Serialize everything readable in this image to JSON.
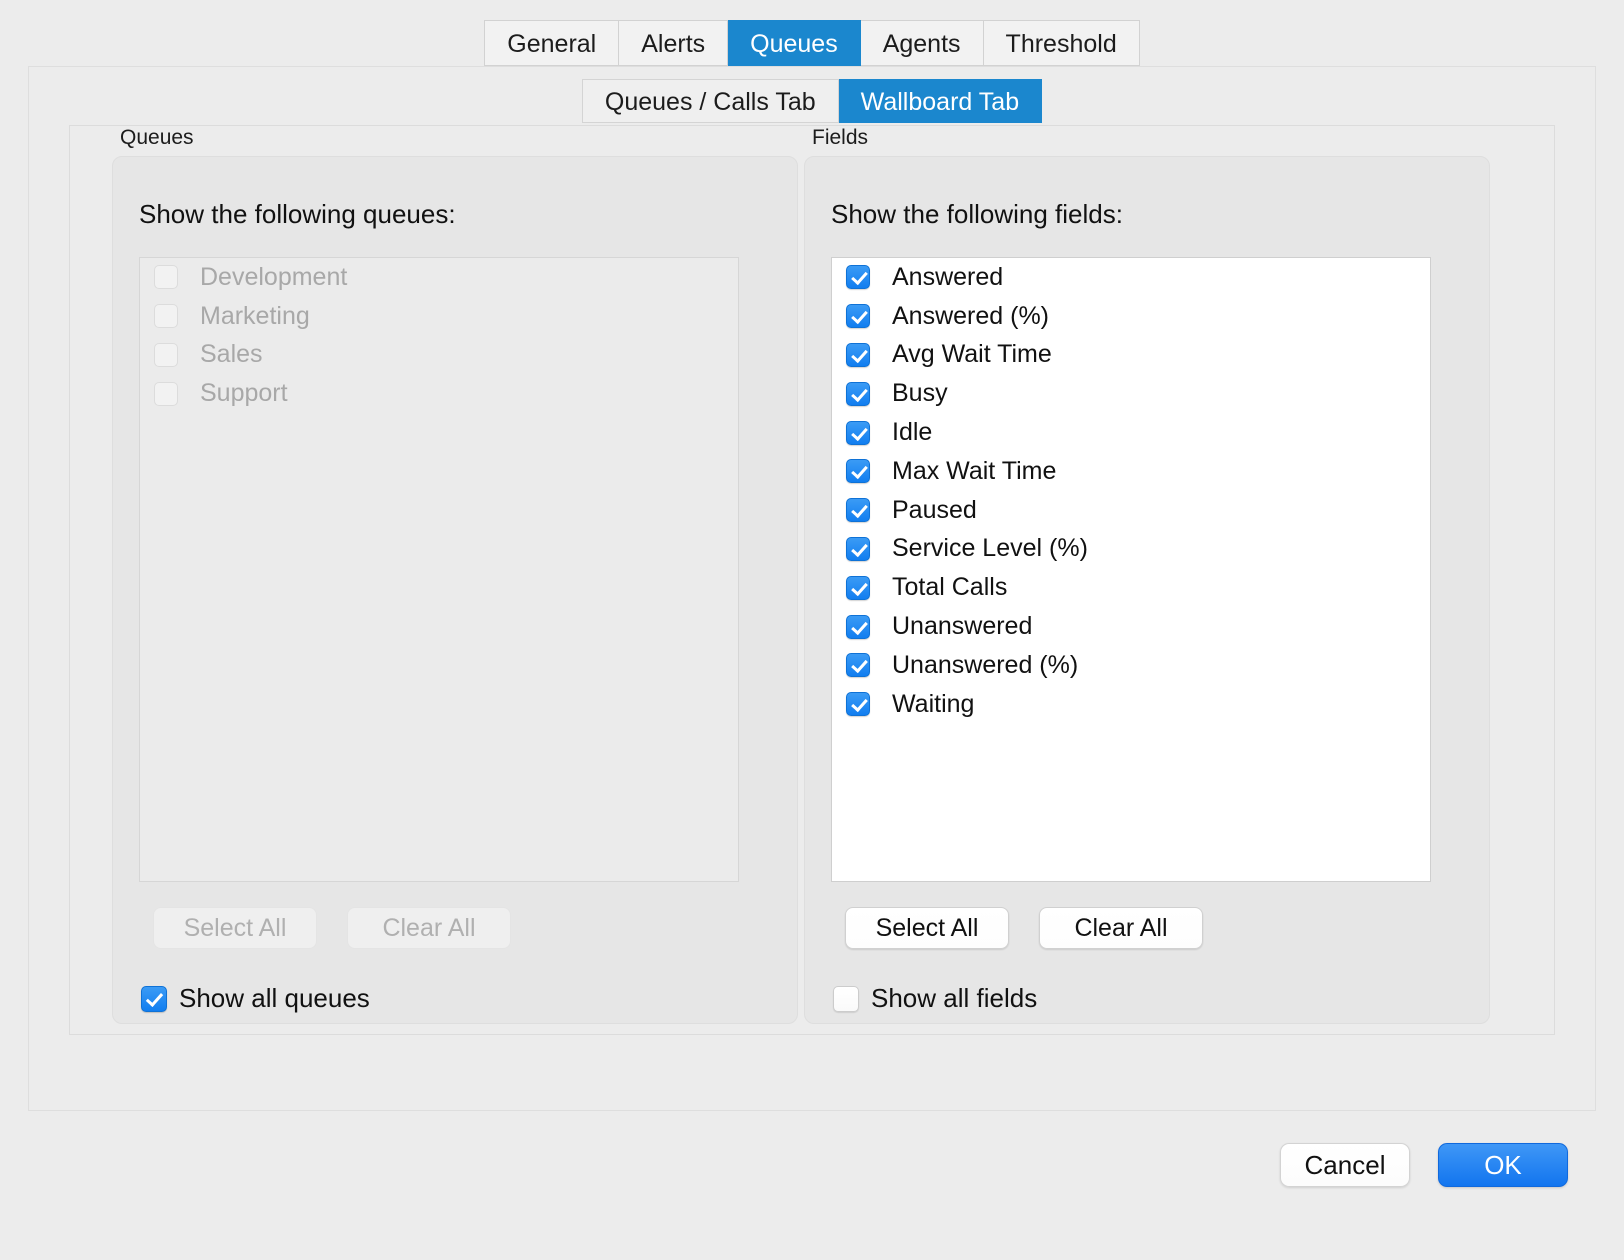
{
  "tabs": [
    {
      "label": "General",
      "active": false
    },
    {
      "label": "Alerts",
      "active": false
    },
    {
      "label": "Queues",
      "active": true
    },
    {
      "label": "Agents",
      "active": false
    },
    {
      "label": "Threshold",
      "active": false
    }
  ],
  "subtabs": [
    {
      "label": "Queues / Calls Tab",
      "active": false
    },
    {
      "label": "Wallboard Tab",
      "active": true
    }
  ],
  "queues_group": {
    "title": "Queues",
    "heading": "Show the following queues:",
    "enabled": false,
    "items": [
      {
        "label": "Development",
        "checked": false
      },
      {
        "label": "Marketing",
        "checked": false
      },
      {
        "label": "Sales",
        "checked": false
      },
      {
        "label": "Support",
        "checked": false
      }
    ],
    "select_all_label": "Select All",
    "clear_all_label": "Clear All",
    "show_all": {
      "label": "Show all queues",
      "checked": true
    }
  },
  "fields_group": {
    "title": "Fields",
    "heading": "Show the following fields:",
    "enabled": true,
    "items": [
      {
        "label": "Answered",
        "checked": true
      },
      {
        "label": "Answered (%)",
        "checked": true
      },
      {
        "label": "Avg Wait Time",
        "checked": true
      },
      {
        "label": "Busy",
        "checked": true
      },
      {
        "label": "Idle",
        "checked": true
      },
      {
        "label": "Max Wait Time",
        "checked": true
      },
      {
        "label": "Paused",
        "checked": true
      },
      {
        "label": "Service Level (%)",
        "checked": true
      },
      {
        "label": "Total Calls",
        "checked": true
      },
      {
        "label": "Unanswered",
        "checked": true
      },
      {
        "label": "Unanswered (%)",
        "checked": true
      },
      {
        "label": "Waiting",
        "checked": true
      }
    ],
    "select_all_label": "Select All",
    "clear_all_label": "Clear All",
    "show_all": {
      "label": "Show all fields",
      "checked": false
    }
  },
  "dialog": {
    "cancel_label": "Cancel",
    "ok_label": "OK"
  },
  "colors": {
    "accent": "#1b87ce",
    "checkbox_blue": "#1a82ef",
    "ok_button": "#1275ef",
    "window_bg": "#ececec",
    "panel_bg": "#e6e6e6",
    "list_bg": "#ffffff",
    "disabled_text": "#a8a8a8"
  }
}
